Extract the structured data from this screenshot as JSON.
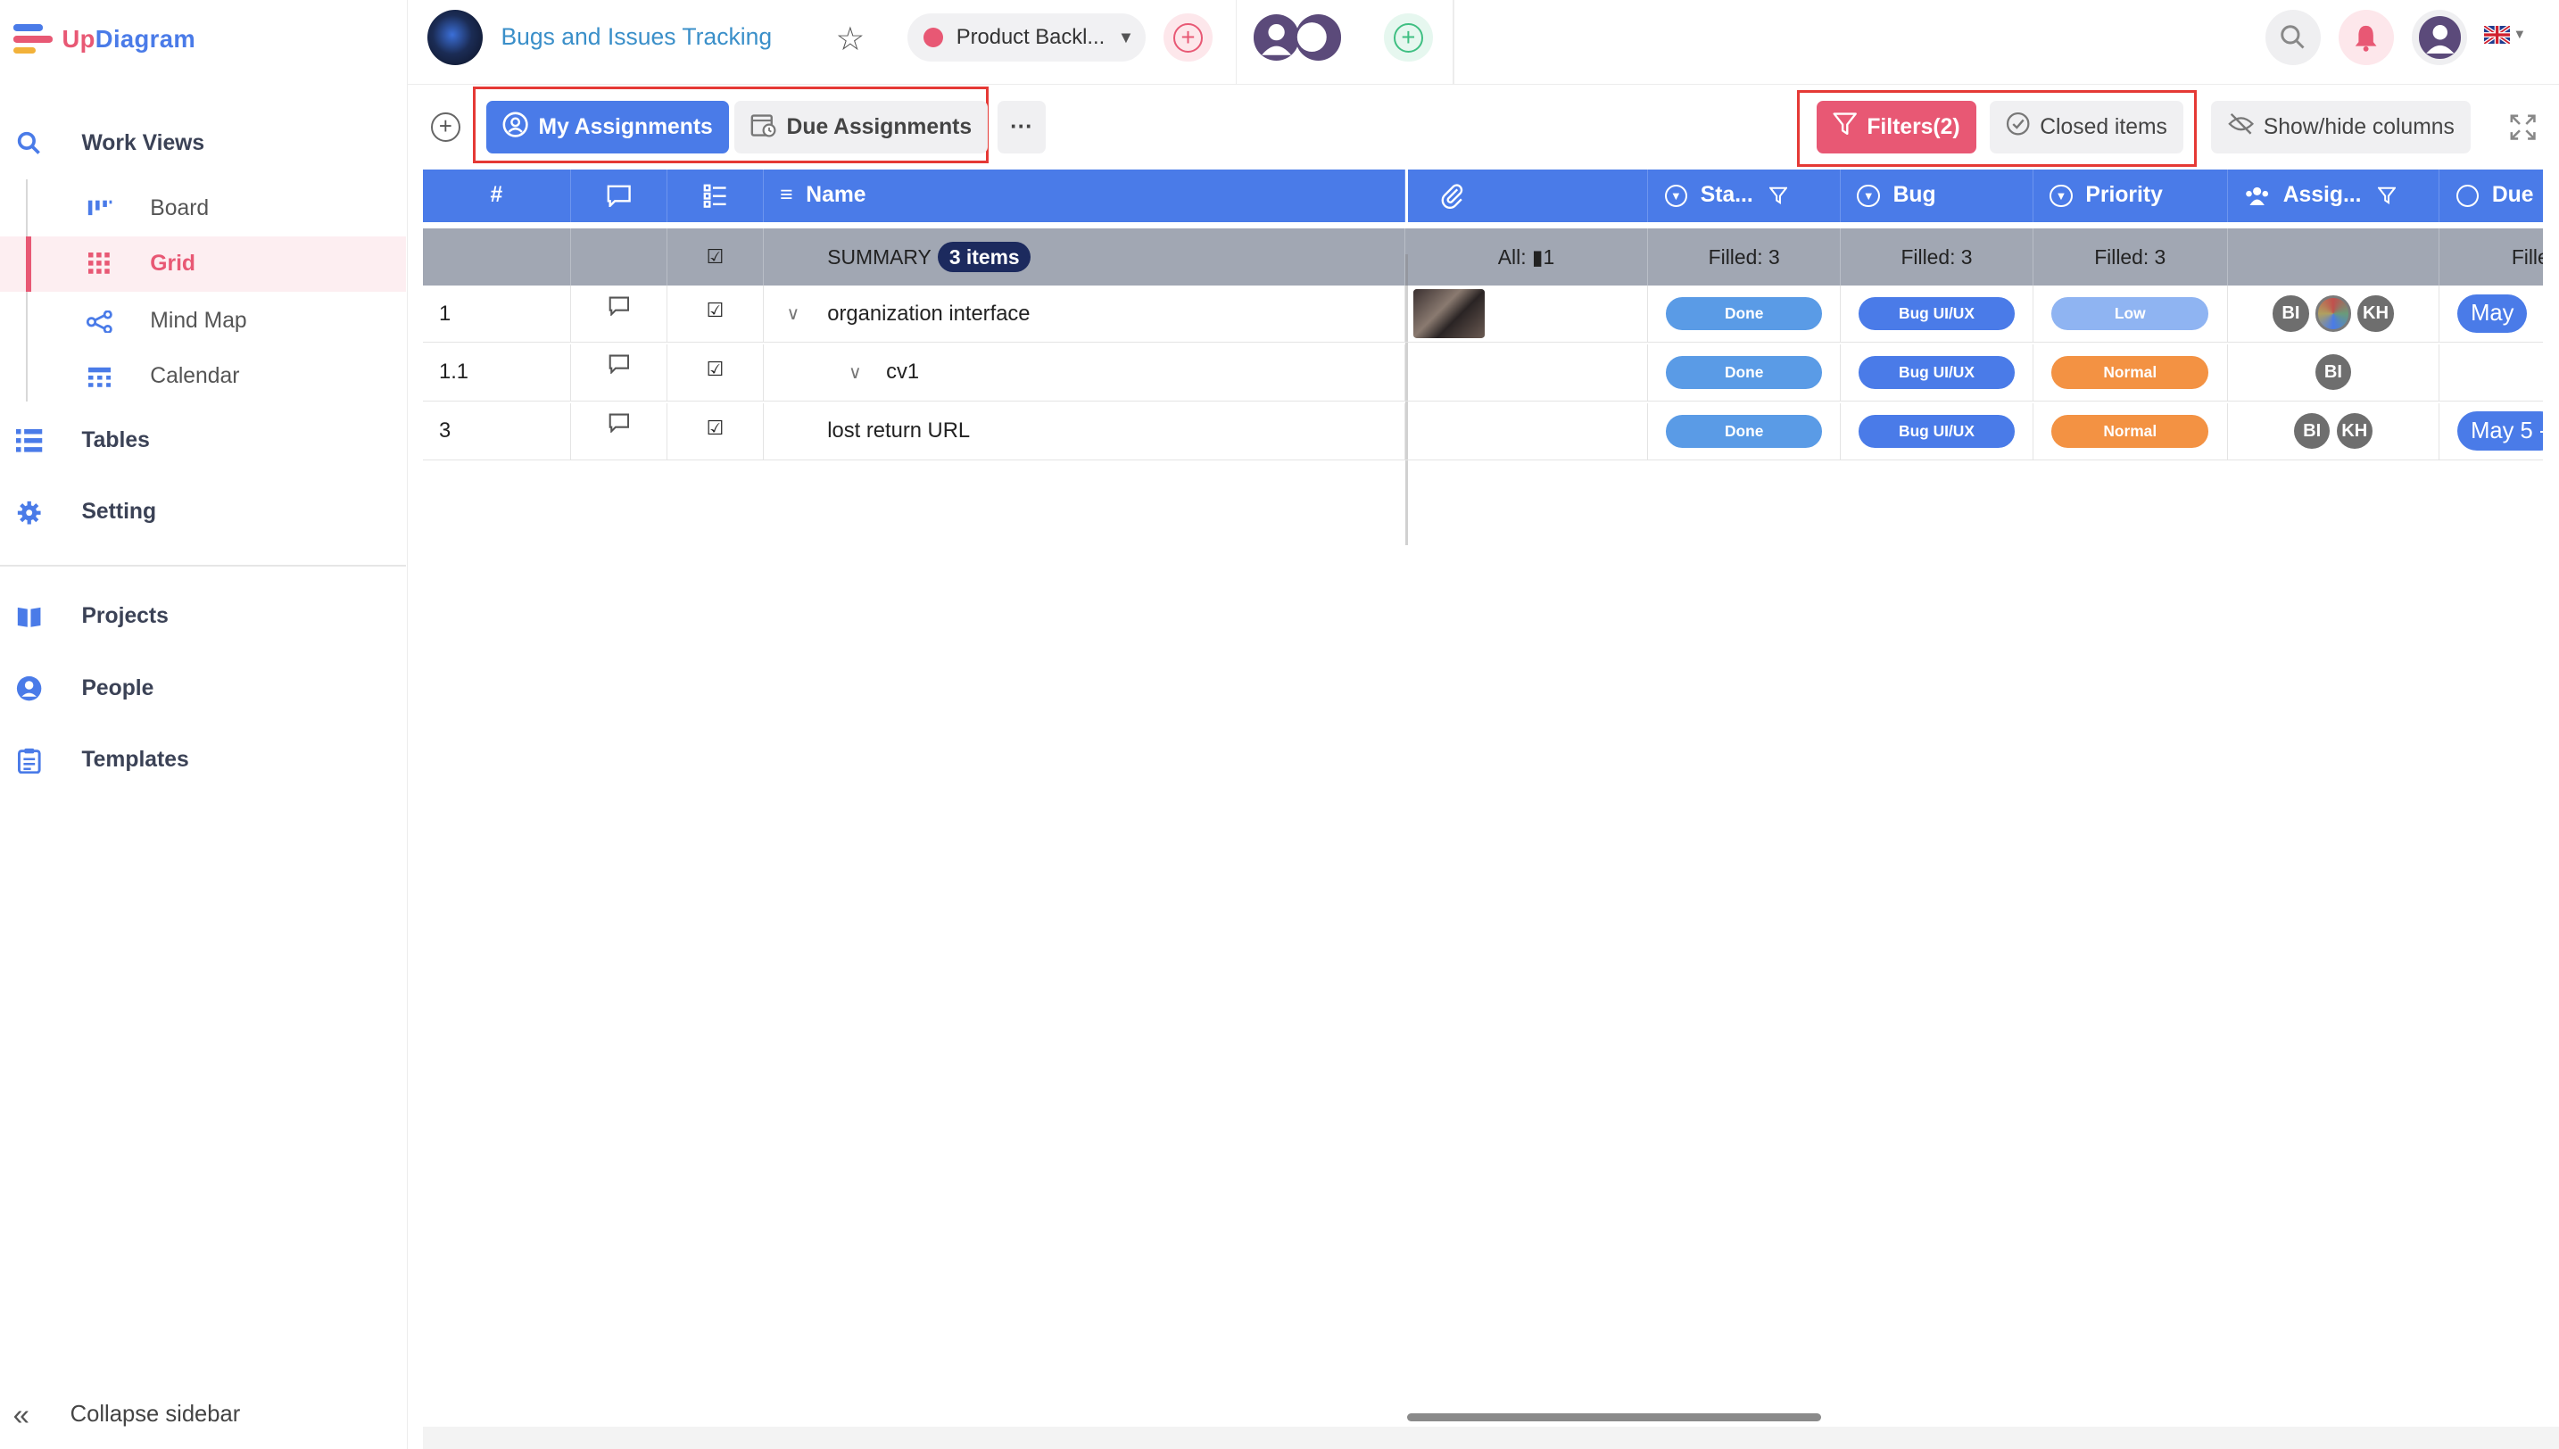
{
  "app": {
    "logo_prefix": "Up",
    "logo_suffix": "Diagram"
  },
  "sidebar": {
    "work_views": "Work Views",
    "views": [
      {
        "label": "Board"
      },
      {
        "label": "Grid"
      },
      {
        "label": "Mind Map"
      },
      {
        "label": "Calendar"
      }
    ],
    "tables": "Tables",
    "setting": "Setting",
    "projects": "Projects",
    "people": "People",
    "templates": "Templates",
    "collapse": "Collapse sidebar"
  },
  "header": {
    "project_title": "Bugs and Issues Tracking",
    "backlog_label": "Product Backl..."
  },
  "toolbar": {
    "my_assignments": "My Assignments",
    "due_assignments": "Due Assignments",
    "more": "···",
    "filters": "Filters(2)",
    "closed_items": "Closed items",
    "show_hide": "Show/hide columns"
  },
  "grid": {
    "columns": {
      "num": "#",
      "name": "Name",
      "status": "Sta...",
      "bug": "Bug",
      "priority": "Priority",
      "assignee": "Assig...",
      "due": "Due"
    },
    "summary": {
      "label": "SUMMARY",
      "count": "3 items",
      "attach": "All: ▮1",
      "status": "Filled: 3",
      "bug": "Filled: 3",
      "priority": "Filled: 3",
      "due": "Fille"
    },
    "rows": [
      {
        "num": "1",
        "name": "organization interface",
        "status": "Done",
        "bug": "Bug UI/UX",
        "priority": "Low",
        "assignees": [
          "BI",
          "",
          "KH"
        ],
        "due": "May"
      },
      {
        "num": "1.1",
        "name": "cv1",
        "status": "Done",
        "bug": "Bug UI/UX",
        "priority": "Normal",
        "assignees": [
          "BI"
        ],
        "due": ""
      },
      {
        "num": "3",
        "name": "lost return URL",
        "status": "Done",
        "bug": "Bug UI/UX",
        "priority": "Normal",
        "assignees": [
          "BI",
          "KH"
        ],
        "due": "May 5 -"
      }
    ]
  },
  "colors": {
    "accent": "#4a7be8",
    "brand_pink": "#e85874",
    "status_done": "#5a9be6",
    "bug": "#4a7be8",
    "priority_low": "#8fb4f2",
    "priority_normal": "#f39243"
  }
}
